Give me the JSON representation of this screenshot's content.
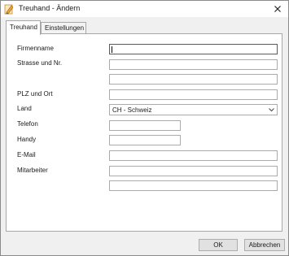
{
  "window": {
    "title": "Treuhand - Ändern",
    "app_icon": "pencil-edit-icon",
    "close_icon": "close-icon"
  },
  "tabs": [
    {
      "label": "Treuhand",
      "active": true
    },
    {
      "label": "Einstellungen",
      "active": false
    }
  ],
  "form": {
    "firmenname": {
      "label": "Firmenname",
      "value": ""
    },
    "strasse": {
      "label": "Strasse und Nr.",
      "value": "",
      "value2": "",
      "value3": ""
    },
    "plz_ort": {
      "label": "PLZ und Ort",
      "value": ""
    },
    "land": {
      "label": "Land",
      "selected": "CH - Schweiz"
    },
    "telefon": {
      "label": "Telefon",
      "value": ""
    },
    "handy": {
      "label": "Handy",
      "value": ""
    },
    "email": {
      "label": "E-Mail",
      "value": ""
    },
    "mitarbeiter": {
      "label": "Mitarbeiter",
      "value": "",
      "value2": ""
    }
  },
  "buttons": {
    "ok": "OK",
    "cancel": "Abbrechen"
  },
  "colors": {
    "window_bg": "#f0f0f0",
    "panel_bg": "#ffffff",
    "border": "#ababab",
    "button_bg": "#e1e1e1",
    "icon_orange": "#e8a33c"
  }
}
